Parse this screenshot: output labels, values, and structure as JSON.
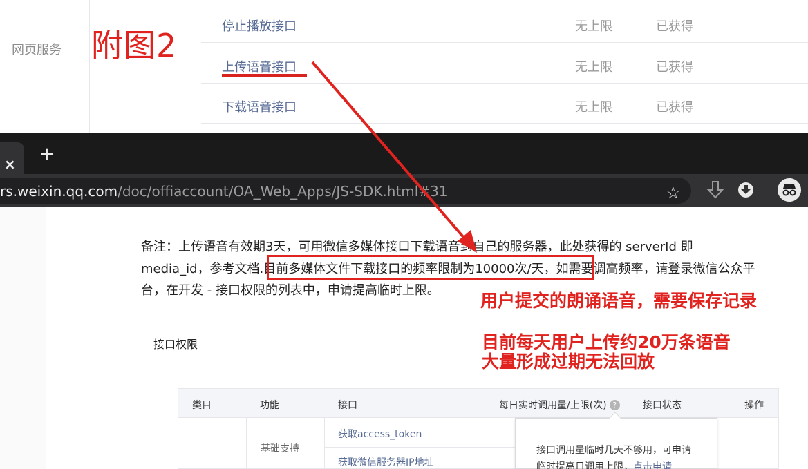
{
  "top_panel": {
    "nav_label": "网页服务",
    "figure_label": "附图2",
    "rows": [
      {
        "name": "停止播放接口",
        "limit": "无上限",
        "status": "已获得"
      },
      {
        "name": "上传语音接口",
        "limit": "无上限",
        "status": "已获得"
      },
      {
        "name": "下载语音接口",
        "limit": "无上限",
        "status": "已获得"
      }
    ]
  },
  "browser": {
    "tab_close": "×",
    "new_tab": "+",
    "url_host": "rs.weixin.qq.com",
    "url_path": "/doc/offiaccount/OA_Web_Apps/JS-SDK.html#31",
    "icons": [
      "star-icon",
      "download-arrow-icon",
      "download-circle-icon",
      "incognito-icon"
    ]
  },
  "doc": {
    "note_line1": "备注：上传语音有效期3天，可用微信多媒体接口下载语音到自己的服务器，此处获得的 serverId 即",
    "note_line2_a": "media_id，参考文档",
    "note_line2_b": ".目前多媒体文件下载接口的频率限制为10000次/天，",
    "note_line2_c": "如需要调高频率，请登录微信公众平",
    "note_line3": "台，在开发 - 接口权限的列表中，申请提高临时上限。",
    "permission_title": "接口权限",
    "table_headers": {
      "category": "类目",
      "function": "功能",
      "api": "接口",
      "quota": "每日实时调用量/上限(次)",
      "help": "?",
      "state": "接口状态",
      "action": "操作"
    },
    "table_cells": {
      "function": "基础支持",
      "api_1": "获取access_token",
      "api_2": "获取微信服务器IP地址"
    },
    "tooltip_line1": "接口调用量临时几天不够用，可申请",
    "tooltip_line2": "临时提高日调用上限，",
    "tooltip_link": "点击申请"
  },
  "annotations": {
    "line_1": "用户提交的朗诵语音，需要保存记录",
    "line_2": "目前每天用户上传约20万条语音",
    "line_3": "大量形成过期无法回放",
    "accent_color": "#e0231f"
  }
}
